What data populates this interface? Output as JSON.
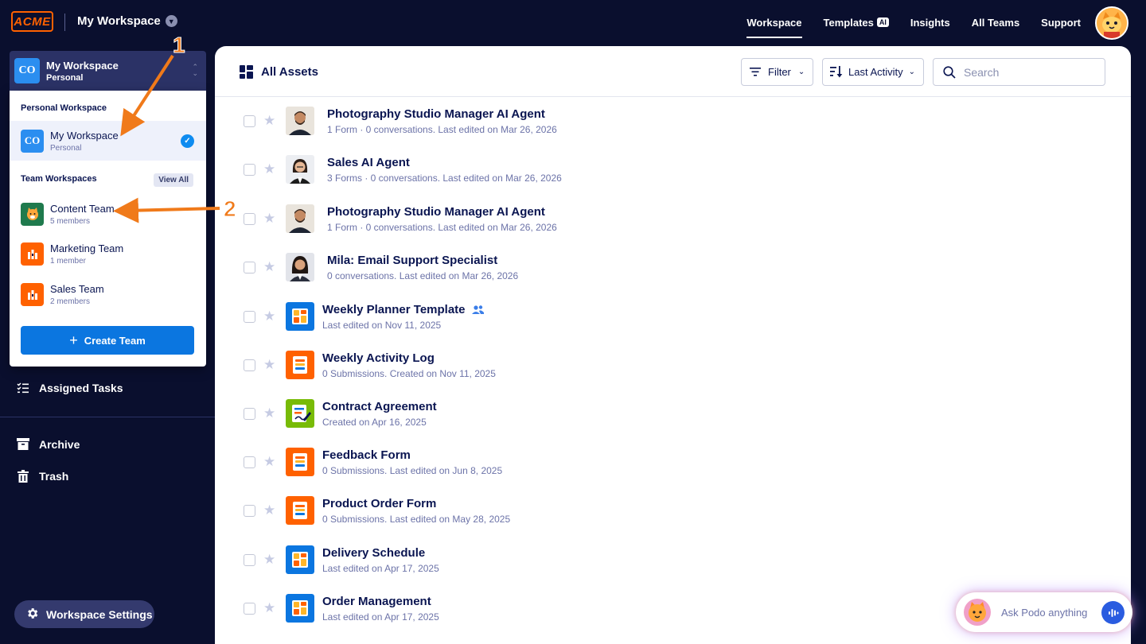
{
  "brand": {
    "logo_text": "ACME",
    "accent": "#ff6100"
  },
  "topbar": {
    "workspace_title": "My Workspace",
    "nav": [
      {
        "label": "Workspace",
        "active": true
      },
      {
        "label": "Templates",
        "badge": "AI"
      },
      {
        "label": "Insights"
      },
      {
        "label": "All Teams"
      },
      {
        "label": "Support"
      }
    ]
  },
  "switcher": {
    "initials": "CO",
    "name": "My Workspace",
    "type": "Personal"
  },
  "dropdown": {
    "personal_heading": "Personal Workspace",
    "personal": {
      "initials": "CO",
      "name": "My Workspace",
      "type": "Personal"
    },
    "team_heading": "Team Workspaces",
    "view_all": "View All",
    "teams": [
      {
        "name": "Content Team",
        "members": "5 members",
        "color": "#1f7a4d"
      },
      {
        "name": "Marketing Team",
        "members": "1 member",
        "color": "#ff6100"
      },
      {
        "name": "Sales Team",
        "members": "2 members",
        "color": "#ff6100"
      }
    ],
    "create_label": "Create Team"
  },
  "sidebar": {
    "assigned_tasks": "Assigned Tasks",
    "archive": "Archive",
    "trash": "Trash",
    "settings": "Workspace Settings"
  },
  "main": {
    "heading": "All Assets",
    "filter_label": "Filter",
    "sort_label": "Last Activity",
    "search_placeholder": "Search",
    "assets": [
      {
        "title": "Photography Studio Manager AI Agent",
        "meta": "1 Form · 0 conversations. Last edited on Mar 26, 2026",
        "kind": "agent-man"
      },
      {
        "title": "Sales AI Agent",
        "meta": "3 Forms · 0 conversations. Last edited on Mar 26, 2026",
        "kind": "agent-woman"
      },
      {
        "title": "Photography Studio Manager AI Agent",
        "meta": "1 Form · 0 conversations. Last edited on Mar 26, 2026",
        "kind": "agent-man"
      },
      {
        "title": "Mila: Email Support Specialist",
        "meta": "0 conversations. Last edited on Mar 26, 2026",
        "kind": "agent-woman2"
      },
      {
        "title": "Weekly Planner Template",
        "meta": "Last edited on Nov 11, 2025",
        "kind": "table",
        "shared": true
      },
      {
        "title": "Weekly Activity Log",
        "meta": "0 Submissions. Created on Nov 11, 2025",
        "kind": "form"
      },
      {
        "title": "Contract Agreement",
        "meta": "Created on Apr 16, 2025",
        "kind": "sign"
      },
      {
        "title": "Feedback Form",
        "meta": "0 Submissions. Last edited on Jun 8, 2025",
        "kind": "form"
      },
      {
        "title": "Product Order Form",
        "meta": "0 Submissions. Last edited on May 28, 2025",
        "kind": "form"
      },
      {
        "title": "Delivery Schedule",
        "meta": "Last edited on Apr 17, 2025",
        "kind": "table"
      },
      {
        "title": "Order Management",
        "meta": "Last edited on Apr 17, 2025",
        "kind": "table"
      }
    ]
  },
  "annotations": {
    "step1": "1",
    "step2": "2"
  },
  "podo": {
    "placeholder": "Ask Podo anything"
  }
}
